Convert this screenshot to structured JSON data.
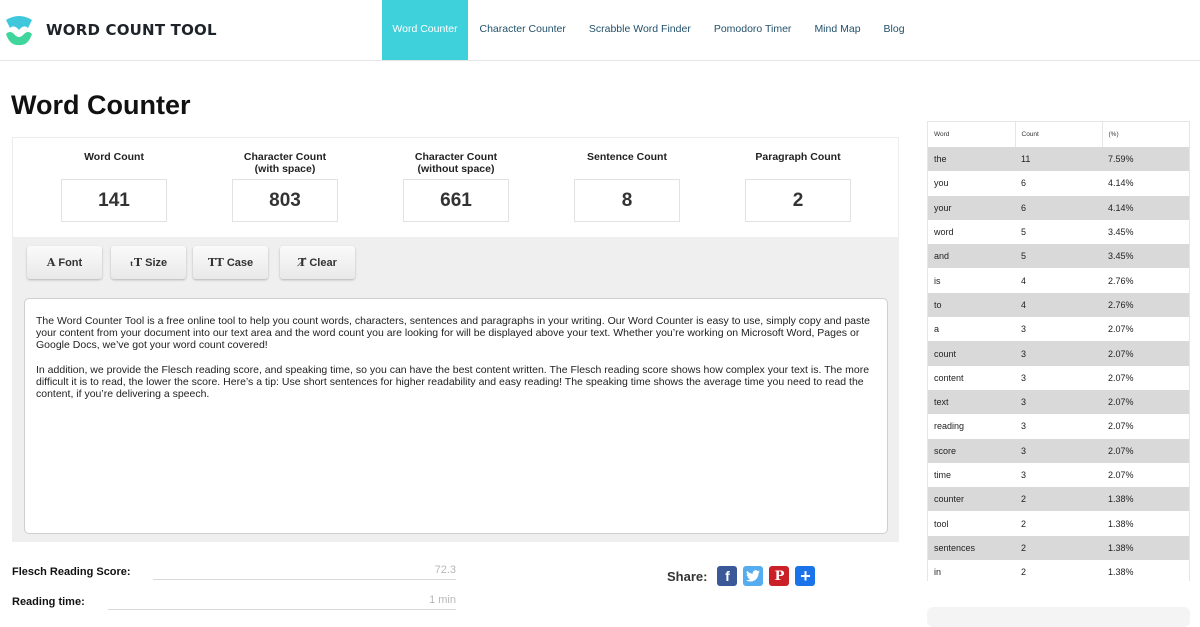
{
  "header": {
    "logo_text": "WORD COUNT TOOL",
    "nav": [
      {
        "label": "Word Counter",
        "active": true
      },
      {
        "label": "Character Counter",
        "active": false
      },
      {
        "label": "Scrabble Word Finder",
        "active": false
      },
      {
        "label": "Pomodoro Timer",
        "active": false
      },
      {
        "label": "Mind Map",
        "active": false
      },
      {
        "label": "Blog",
        "active": false
      }
    ]
  },
  "page_title": "Word Counter",
  "stats": [
    {
      "label": "Word Count",
      "value": "141"
    },
    {
      "label": "Character Count\n(with space)",
      "value": "803"
    },
    {
      "label": "Character Count\n(without space)",
      "value": "661"
    },
    {
      "label": "Sentence Count",
      "value": "8"
    },
    {
      "label": "Paragraph Count",
      "value": "2"
    }
  ],
  "toolbar": {
    "font": {
      "icon": "A",
      "label": "Font"
    },
    "size": {
      "icon": "ₜT",
      "label": "Size"
    },
    "case": {
      "icon": "TT",
      "label": "Case"
    },
    "clear": {
      "icon": "T̸",
      "label": "Clear"
    }
  },
  "editor": {
    "paragraphs": [
      "The Word Counter Tool is a free online tool to help you count words, characters, sentences and paragraphs in your writing. Our Word Counter is easy to use, simply copy and paste your content from your document into our text area and the word count you are looking for will be displayed above your text. Whether you’re working on Microsoft Word, Pages or Google Docs, we’ve got your word count covered!",
      "In addition, we provide the Flesch reading score, and speaking time, so you can have the best content written. The Flesch reading score shows how complex your text is. The more difficult it is to read, the lower the score. Here’s a tip: Use short sentences for higher readability and easy reading! The speaking time shows the average time you need to read the content, if you’re delivering a speech."
    ]
  },
  "metrics": {
    "flesch_label": "Flesch Reading Score:",
    "flesch_value": "72.3",
    "reading_label": "Reading time:",
    "reading_value": "1 min"
  },
  "share": {
    "label": "Share:",
    "buttons": [
      {
        "name": "facebook",
        "glyph": "f",
        "color": "#3b5998"
      },
      {
        "name": "twitter",
        "glyph": "t",
        "color": "#55acee"
      },
      {
        "name": "pinterest",
        "glyph": "P",
        "color": "#cb2027"
      },
      {
        "name": "more",
        "glyph": "+",
        "color": "#1a73e8"
      }
    ]
  },
  "frequency_table": {
    "headers": [
      "Word",
      "Count",
      "(%)"
    ],
    "rows": [
      [
        "the",
        "11",
        "7.59%"
      ],
      [
        "you",
        "6",
        "4.14%"
      ],
      [
        "your",
        "6",
        "4.14%"
      ],
      [
        "word",
        "5",
        "3.45%"
      ],
      [
        "and",
        "5",
        "3.45%"
      ],
      [
        "is",
        "4",
        "2.76%"
      ],
      [
        "to",
        "4",
        "2.76%"
      ],
      [
        "a",
        "3",
        "2.07%"
      ],
      [
        "count",
        "3",
        "2.07%"
      ],
      [
        "content",
        "3",
        "2.07%"
      ],
      [
        "text",
        "3",
        "2.07%"
      ],
      [
        "reading",
        "3",
        "2.07%"
      ],
      [
        "score",
        "3",
        "2.07%"
      ],
      [
        "time",
        "3",
        "2.07%"
      ],
      [
        "counter",
        "2",
        "1.38%"
      ],
      [
        "tool",
        "2",
        "1.38%"
      ],
      [
        "sentences",
        "2",
        "1.38%"
      ],
      [
        "in",
        "2",
        "1.38%"
      ]
    ]
  },
  "colors": {
    "accent": "#3fd1db",
    "nav_text": "#23516b"
  }
}
